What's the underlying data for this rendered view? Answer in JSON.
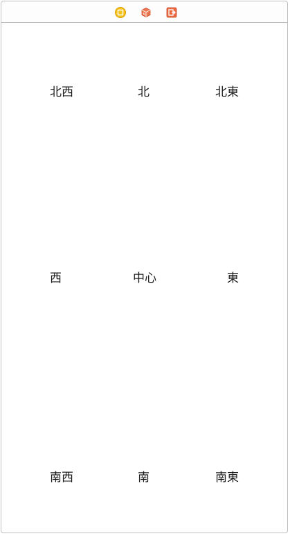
{
  "toolbar": {
    "icons": [
      "view-controller-icon",
      "first-responder-icon",
      "exit-icon"
    ],
    "colors": {
      "view_controller": "#f2b705",
      "first_responder": "#e8613c",
      "exit": "#e8613c"
    }
  },
  "labels": {
    "northwest": "北西",
    "north": "北",
    "northeast": "北東",
    "west": "西",
    "center": "中心",
    "east": "東",
    "southwest": "南西",
    "south": "南",
    "southeast": "南東"
  }
}
